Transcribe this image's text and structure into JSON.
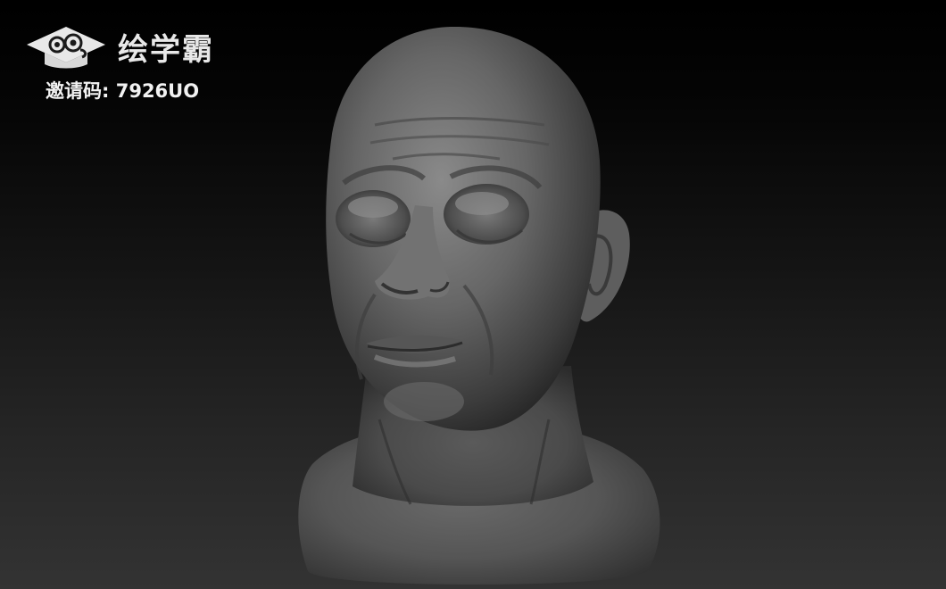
{
  "brand": {
    "icon": "graduation-cap-cloud-logo",
    "name": "绘学霸"
  },
  "invite": {
    "label": "邀请码:",
    "code": "7926UO"
  },
  "viewport": {
    "subject": "sculpted-head-bust",
    "background_top": "#000000",
    "background_bottom": "#333333",
    "material_color": "#6e6e6e"
  }
}
